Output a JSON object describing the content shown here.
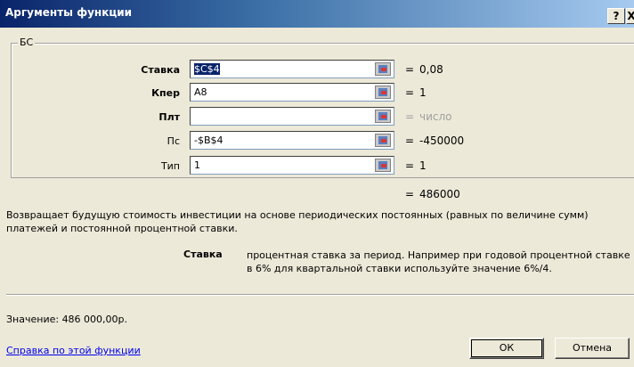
{
  "window": {
    "title": "Аргументы функции",
    "help_glyph": "?",
    "close_glyph": "X"
  },
  "group_label": "БС",
  "args": [
    {
      "label": "Ставка",
      "bold": true,
      "value": "$C$4",
      "selected": true,
      "eq": "=",
      "result": "0,08",
      "dim": false
    },
    {
      "label": "Кпер",
      "bold": true,
      "value": "A8",
      "selected": false,
      "eq": "=",
      "result": "1",
      "dim": false
    },
    {
      "label": "Плт",
      "bold": true,
      "value": "",
      "selected": false,
      "eq": "=",
      "result": "число",
      "dim": true
    },
    {
      "label": "Пс",
      "bold": false,
      "value": "-$B$4",
      "selected": false,
      "eq": "=",
      "result": "-450000",
      "dim": false
    },
    {
      "label": "Тип",
      "bold": false,
      "value": "1",
      "selected": false,
      "eq": "=",
      "result": "1",
      "dim": false
    }
  ],
  "result": {
    "eq": "=",
    "value": "486000"
  },
  "description": "Возвращает будущую стоимость инвестиции на основе периодических постоянных (равных по величине сумм) платежей и постоянной процентной ставки.",
  "arg_help": {
    "name": "Ставка",
    "text": "процентная ставка за период. Например при годовой процентной ставке в 6% для квартальной ставки используйте значение 6%/4."
  },
  "value_line": "Значение:  486 000,00р.",
  "help_link": "Справка по этой функции",
  "buttons": {
    "ok": "ОК",
    "cancel": "Отмена"
  }
}
